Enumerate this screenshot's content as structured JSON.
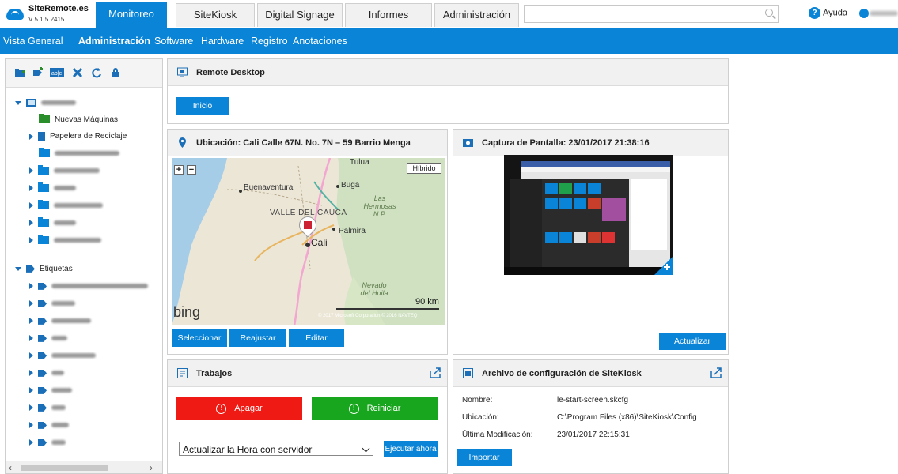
{
  "app": {
    "name": "SiteRemote.es",
    "version": "V 5.1.5.2415"
  },
  "tabs": [
    {
      "label": "Monitoreo"
    },
    {
      "label": "SiteKiosk"
    },
    {
      "label": "Digital Signage"
    },
    {
      "label": "Informes"
    },
    {
      "label": "Administración"
    }
  ],
  "search": {
    "placeholder": ""
  },
  "help_label": "Ayuda",
  "subnav": [
    "Vista General",
    "Administración",
    "Software",
    "Hardware",
    "Registro",
    "Anotaciones"
  ],
  "tree": {
    "new_machines": "Nuevas Máquinas",
    "recycle_bin": "Papelera de Reciclaje",
    "tags": "Etiquetas"
  },
  "remote_desktop": {
    "title": "Remote Desktop",
    "start_button": "Inicio"
  },
  "location": {
    "title": "Ubicación: Cali Calle 67N. No. 7N – 59 Barrio Menga",
    "hybrid_button": "Híbrido",
    "map_labels": [
      "Tulua",
      "Buga",
      "Buenaventura",
      "VALLE DEL CAUCA",
      "Las Hermosas N.P.",
      "Palmira",
      "Cali",
      "Nevado del Huila",
      "90 km"
    ],
    "bing": "bing",
    "copyright": "© 2017 Microsoft Corporation   © 2016 NAVTEQ",
    "buttons": [
      "Seleccionar",
      "Reajustar",
      "Editar"
    ]
  },
  "screenshot": {
    "title": "Captura de Pantalla: 23/01/2017 21:38:16",
    "update_button": "Actualizar"
  },
  "jobs": {
    "title": "Trabajos",
    "shutdown": "Apagar",
    "restart": "Reiniciar",
    "selected_job": "Actualizar la Hora con servidor",
    "run_now": "Ejecutar ahora"
  },
  "config": {
    "title": "Archivo de configuración de SiteKiosk",
    "rows": [
      {
        "key": "Nombre:",
        "value": "le-start-screen.skcfg"
      },
      {
        "key": "Ubicación:",
        "value": "C:\\Program Files (x86)\\SiteKiosk\\Config"
      },
      {
        "key": "Última Modificación:",
        "value": "23/01/2017 22:15:31"
      }
    ],
    "import_button": "Importar"
  },
  "colors": {
    "accent": "#0a84d6",
    "danger": "#f01a14",
    "success": "#19a61f"
  }
}
